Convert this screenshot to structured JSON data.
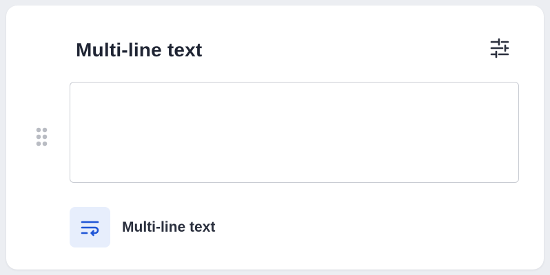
{
  "field": {
    "title": "Multi-line text",
    "input_value": "",
    "input_placeholder": ""
  },
  "type_badge": {
    "label": "Multi-line text",
    "icon": "text-wrap-icon"
  },
  "icons": {
    "settings": "sliders-icon",
    "drag": "drag-handle-icon"
  },
  "colors": {
    "accent": "#1f55d6",
    "accent_bg": "#e7eefc",
    "text": "#1f2433",
    "handle": "#b9bcc3"
  }
}
